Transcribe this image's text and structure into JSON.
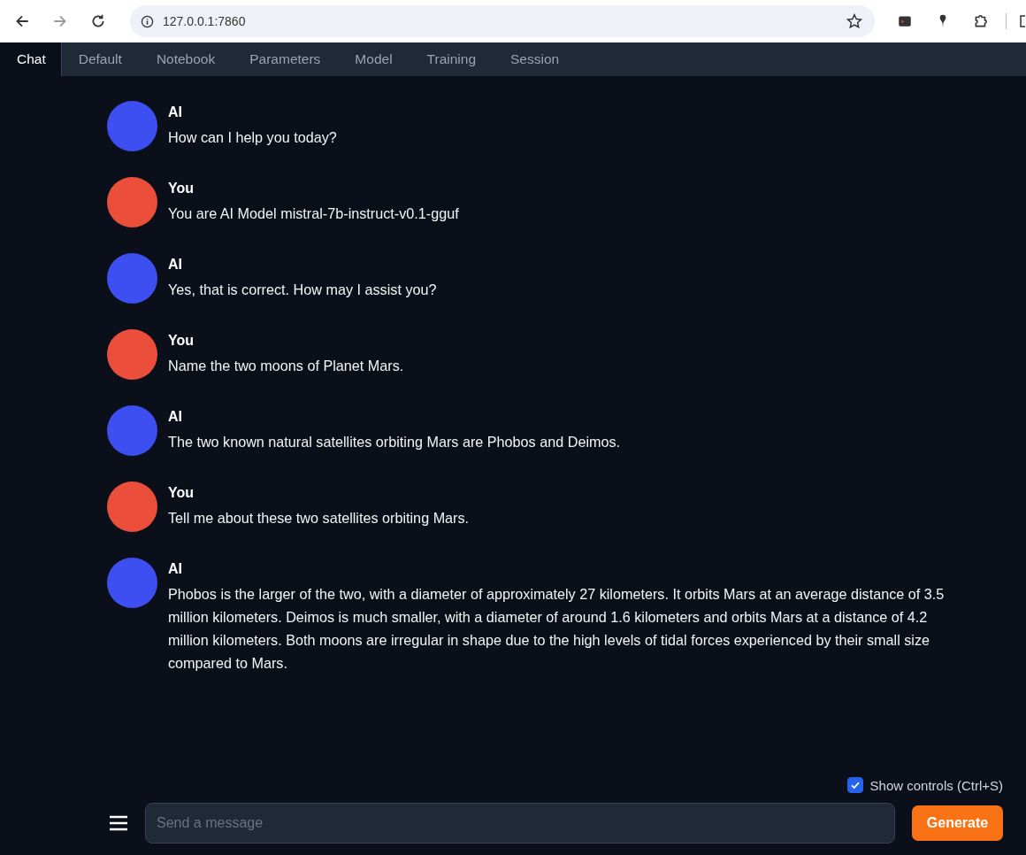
{
  "browser": {
    "url": "127.0.0.1:7860"
  },
  "tabs": [
    {
      "label": "Chat",
      "selected": true
    },
    {
      "label": "Default",
      "selected": false
    },
    {
      "label": "Notebook",
      "selected": false
    },
    {
      "label": "Parameters",
      "selected": false
    },
    {
      "label": "Model",
      "selected": false
    },
    {
      "label": "Training",
      "selected": false
    },
    {
      "label": "Session",
      "selected": false
    }
  ],
  "messages": [
    {
      "kind": "bot",
      "author": "AI",
      "text": "How can I help you today?"
    },
    {
      "kind": "user",
      "author": "You",
      "text": "You are AI Model mistral-7b-instruct-v0.1-gguf"
    },
    {
      "kind": "bot",
      "author": "AI",
      "text": "Yes, that is correct. How may I assist you?"
    },
    {
      "kind": "user",
      "author": "You",
      "text": "Name the two moons of Planet Mars."
    },
    {
      "kind": "bot",
      "author": "AI",
      "text": "The two known natural satellites orbiting Mars are Phobos and Deimos."
    },
    {
      "kind": "user",
      "author": "You",
      "text": "Tell me about these two satellites orbiting Mars."
    },
    {
      "kind": "bot",
      "author": "AI",
      "text": "Phobos is the larger of the two, with a diameter of approximately 27 kilometers. It orbits Mars at an average distance of 3.5 million kilometers. Deimos is much smaller, with a diameter of around 1.6 kilometers and orbits Mars at a distance of 4.2 million kilometers. Both moons are irregular in shape due to the high levels of tidal forces experienced by their small size compared to Mars."
    }
  ],
  "show_controls": {
    "label": "Show controls (Ctrl+S)",
    "checked": true
  },
  "input": {
    "placeholder": "Send a message"
  },
  "generate_button": "Generate"
}
